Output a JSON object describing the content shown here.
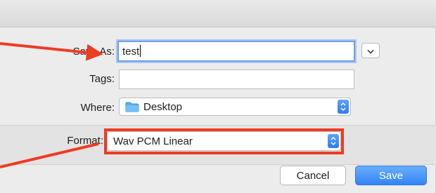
{
  "dialog": {
    "save_as_label": "Save As:",
    "filename_value": "test",
    "tags_label": "Tags:",
    "tags_value": "",
    "where_label": "Where:",
    "where_value": "Desktop",
    "format_label": "Format:",
    "format_value": "Wav PCM Linear",
    "cancel_label": "Cancel",
    "save_label": "Save"
  },
  "icons": {
    "expand": "chevron-down-icon",
    "folder": "folder-icon",
    "stepper": "up-down-chevron-icon"
  },
  "colors": {
    "accent_blue": "#3283f5",
    "annotation_red": "#ee3b23",
    "sheet_bg": "#ececec"
  }
}
